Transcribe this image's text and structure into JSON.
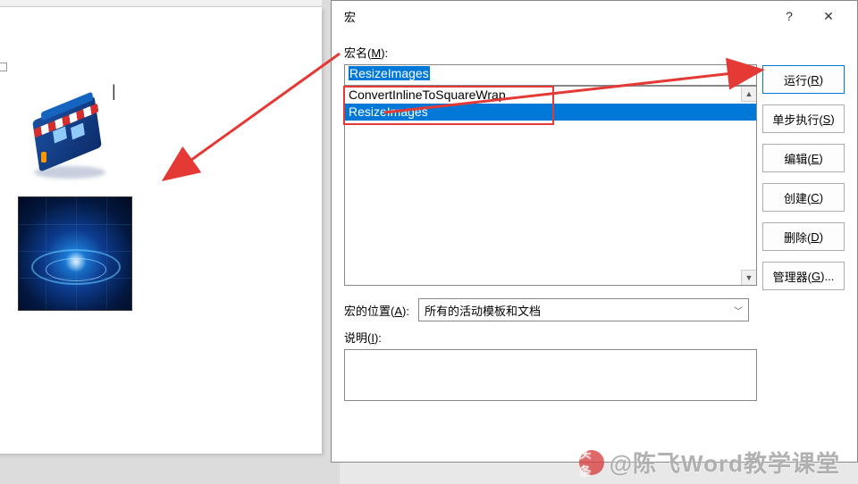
{
  "dialog": {
    "title": "宏",
    "help": "?",
    "close": "✕",
    "macro_name_label": "宏名(M):",
    "macro_name_value": "ResizeImages",
    "list_items": [
      "ConvertInlineToSquareWrap",
      "ResizeImages"
    ],
    "selected_index": 1,
    "location_label": "宏的位置(A):",
    "location_value": "所有的活动模板和文档",
    "description_label": "说明(I):",
    "buttons": {
      "run": "运行(R)",
      "step": "单步执行(S)",
      "edit": "编辑(E)",
      "create": "创建(C)",
      "delete": "删除(D)",
      "organizer": "管理器(G)..."
    }
  },
  "watermark": {
    "logo": "头条",
    "text": "@陈飞Word教学课堂"
  }
}
